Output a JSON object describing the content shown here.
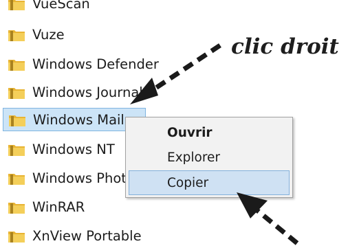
{
  "folders": [
    {
      "label": "VueScan"
    },
    {
      "label": "Vuze"
    },
    {
      "label": "Windows Defender"
    },
    {
      "label": "Windows Journal"
    },
    {
      "label": "Windows Mail"
    },
    {
      "label": "Windows NT"
    },
    {
      "label": "Windows Photo Viewer"
    },
    {
      "label": "WinRAR"
    },
    {
      "label": "XnView Portable"
    }
  ],
  "context_menu": {
    "items": [
      {
        "label": "Ouvrir",
        "style": "default-bold"
      },
      {
        "label": "Explorer"
      },
      {
        "label": "Copier",
        "state": "hovered"
      }
    ]
  },
  "annotation": {
    "text": "clic droit"
  },
  "colors": {
    "selection_fill": "#cce4f7",
    "selection_border": "#7fb4e0",
    "menu_background": "#f2f2f2",
    "menu_hover": "#cfe1f3",
    "folder_icon": "#e8b434",
    "arrow": "#1a1a1a"
  },
  "icons": {
    "folder": "folder-icon",
    "arrow": "dashed-arrow"
  }
}
